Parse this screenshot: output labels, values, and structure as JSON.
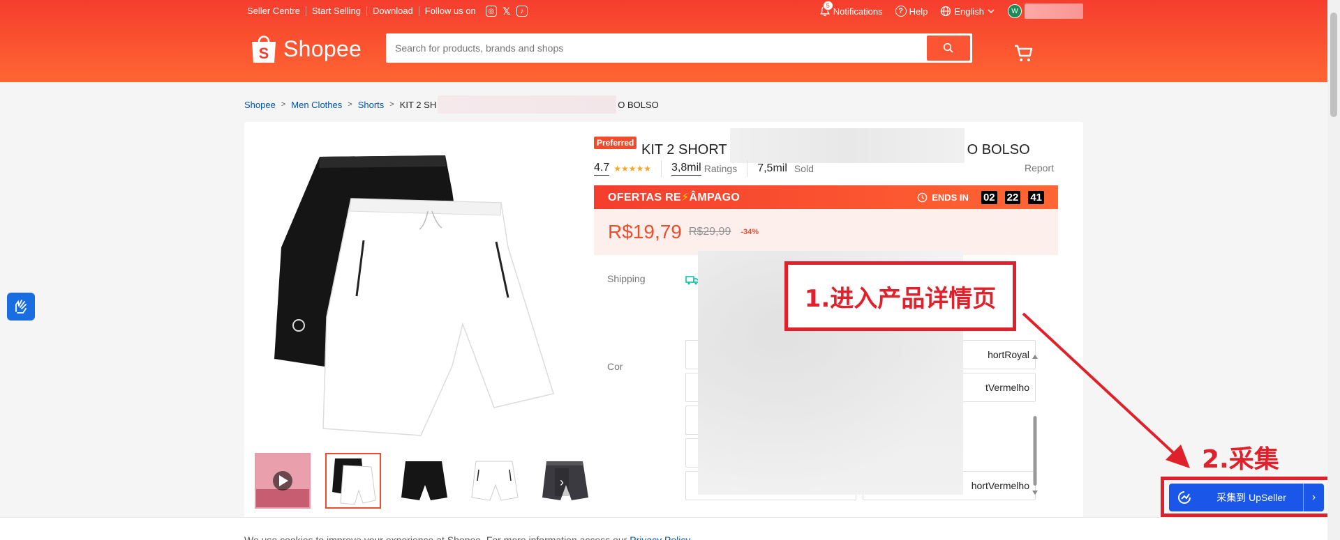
{
  "topnav": {
    "seller_centre": "Seller Centre",
    "start_selling": "Start Selling",
    "download": "Download",
    "follow_us": "Follow us on",
    "notifications": "Notifications",
    "notif_count": "5",
    "help": "Help",
    "language": "English",
    "avatar_letter": "W"
  },
  "header": {
    "logo_text": "Shopee",
    "search_placeholder": "Search for products, brands and shops"
  },
  "breadcrumb": {
    "items": [
      "Shopee",
      "Men Clothes",
      "Shorts"
    ],
    "current_start": "KIT 2 SH",
    "current_end": "O BOLSO"
  },
  "product": {
    "badge": "Preferred",
    "title_start": "KIT 2 SHORT",
    "title_end": "O BOLSO",
    "rating": "4.7",
    "stars": "★★★★★",
    "ratings_count": "3,8mil",
    "ratings_label": "Ratings",
    "sold_count": "7,5mil",
    "sold_label": "Sold",
    "report": "Report",
    "flash_title_a": "OFERTAS RE",
    "flash_title_b": "ÂMPAGO",
    "ends_in": "ENDS IN",
    "timer": [
      "02",
      "22",
      "41"
    ],
    "price": "R$19,79",
    "old_price": "R$29,99",
    "discount": "-34%",
    "shipping_label": "Shipping",
    "color_label": "Cor",
    "variants_right": [
      "hortRoyal",
      "tVermelho",
      "",
      "",
      "hortVermelho"
    ]
  },
  "annotations": {
    "step1": "1.进入产品详情页",
    "step2": "2.采集"
  },
  "upseller": {
    "label": "采集到 UpSeller"
  },
  "cookie": {
    "text": "We use cookies to improve your experience at Shopee. For more information access our",
    "link": "Privacy Policy"
  },
  "colors": {
    "brand": "#ee4d2d",
    "annotation_red": "#e0202a",
    "upseller_blue": "#1a56e8"
  }
}
